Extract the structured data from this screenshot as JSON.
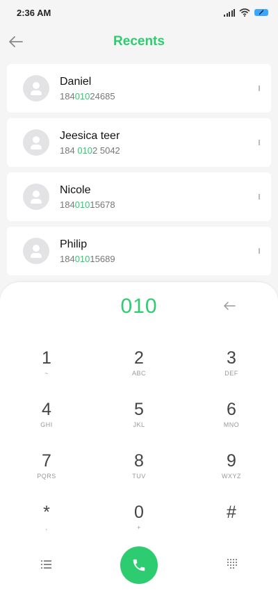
{
  "status": {
    "time": "2:36 AM",
    "battery_color": "#3aa6ff"
  },
  "header": {
    "title": "Recents",
    "back_icon": "back-arrow-icon"
  },
  "contacts": [
    {
      "name": "Daniel",
      "num_pre": "184",
      "num_match": "010",
      "num_post": "24685"
    },
    {
      "name": "Jeesica teer",
      "num_pre": "184 ",
      "num_match": "010",
      "num_post": "2 5042"
    },
    {
      "name": "Nicole",
      "num_pre": "184",
      "num_match": "010",
      "num_post": "15678"
    },
    {
      "name": "Philip",
      "num_pre": "184",
      "num_match": "010",
      "num_post": "15689"
    }
  ],
  "dialpad": {
    "input": "010",
    "keys": [
      {
        "digit": "1",
        "letters": "~"
      },
      {
        "digit": "2",
        "letters": "ABC"
      },
      {
        "digit": "3",
        "letters": "DEF"
      },
      {
        "digit": "4",
        "letters": "GHI"
      },
      {
        "digit": "5",
        "letters": "JKL"
      },
      {
        "digit": "6",
        "letters": "MNO"
      },
      {
        "digit": "7",
        "letters": "PQRS"
      },
      {
        "digit": "8",
        "letters": "TUV"
      },
      {
        "digit": "9",
        "letters": "WXYZ"
      },
      {
        "digit": "*",
        "letters": ","
      },
      {
        "digit": "0",
        "letters": "+"
      },
      {
        "digit": "#",
        "letters": ""
      }
    ]
  },
  "colors": {
    "accent": "#2ecc71",
    "background": "#f5f5f5"
  }
}
